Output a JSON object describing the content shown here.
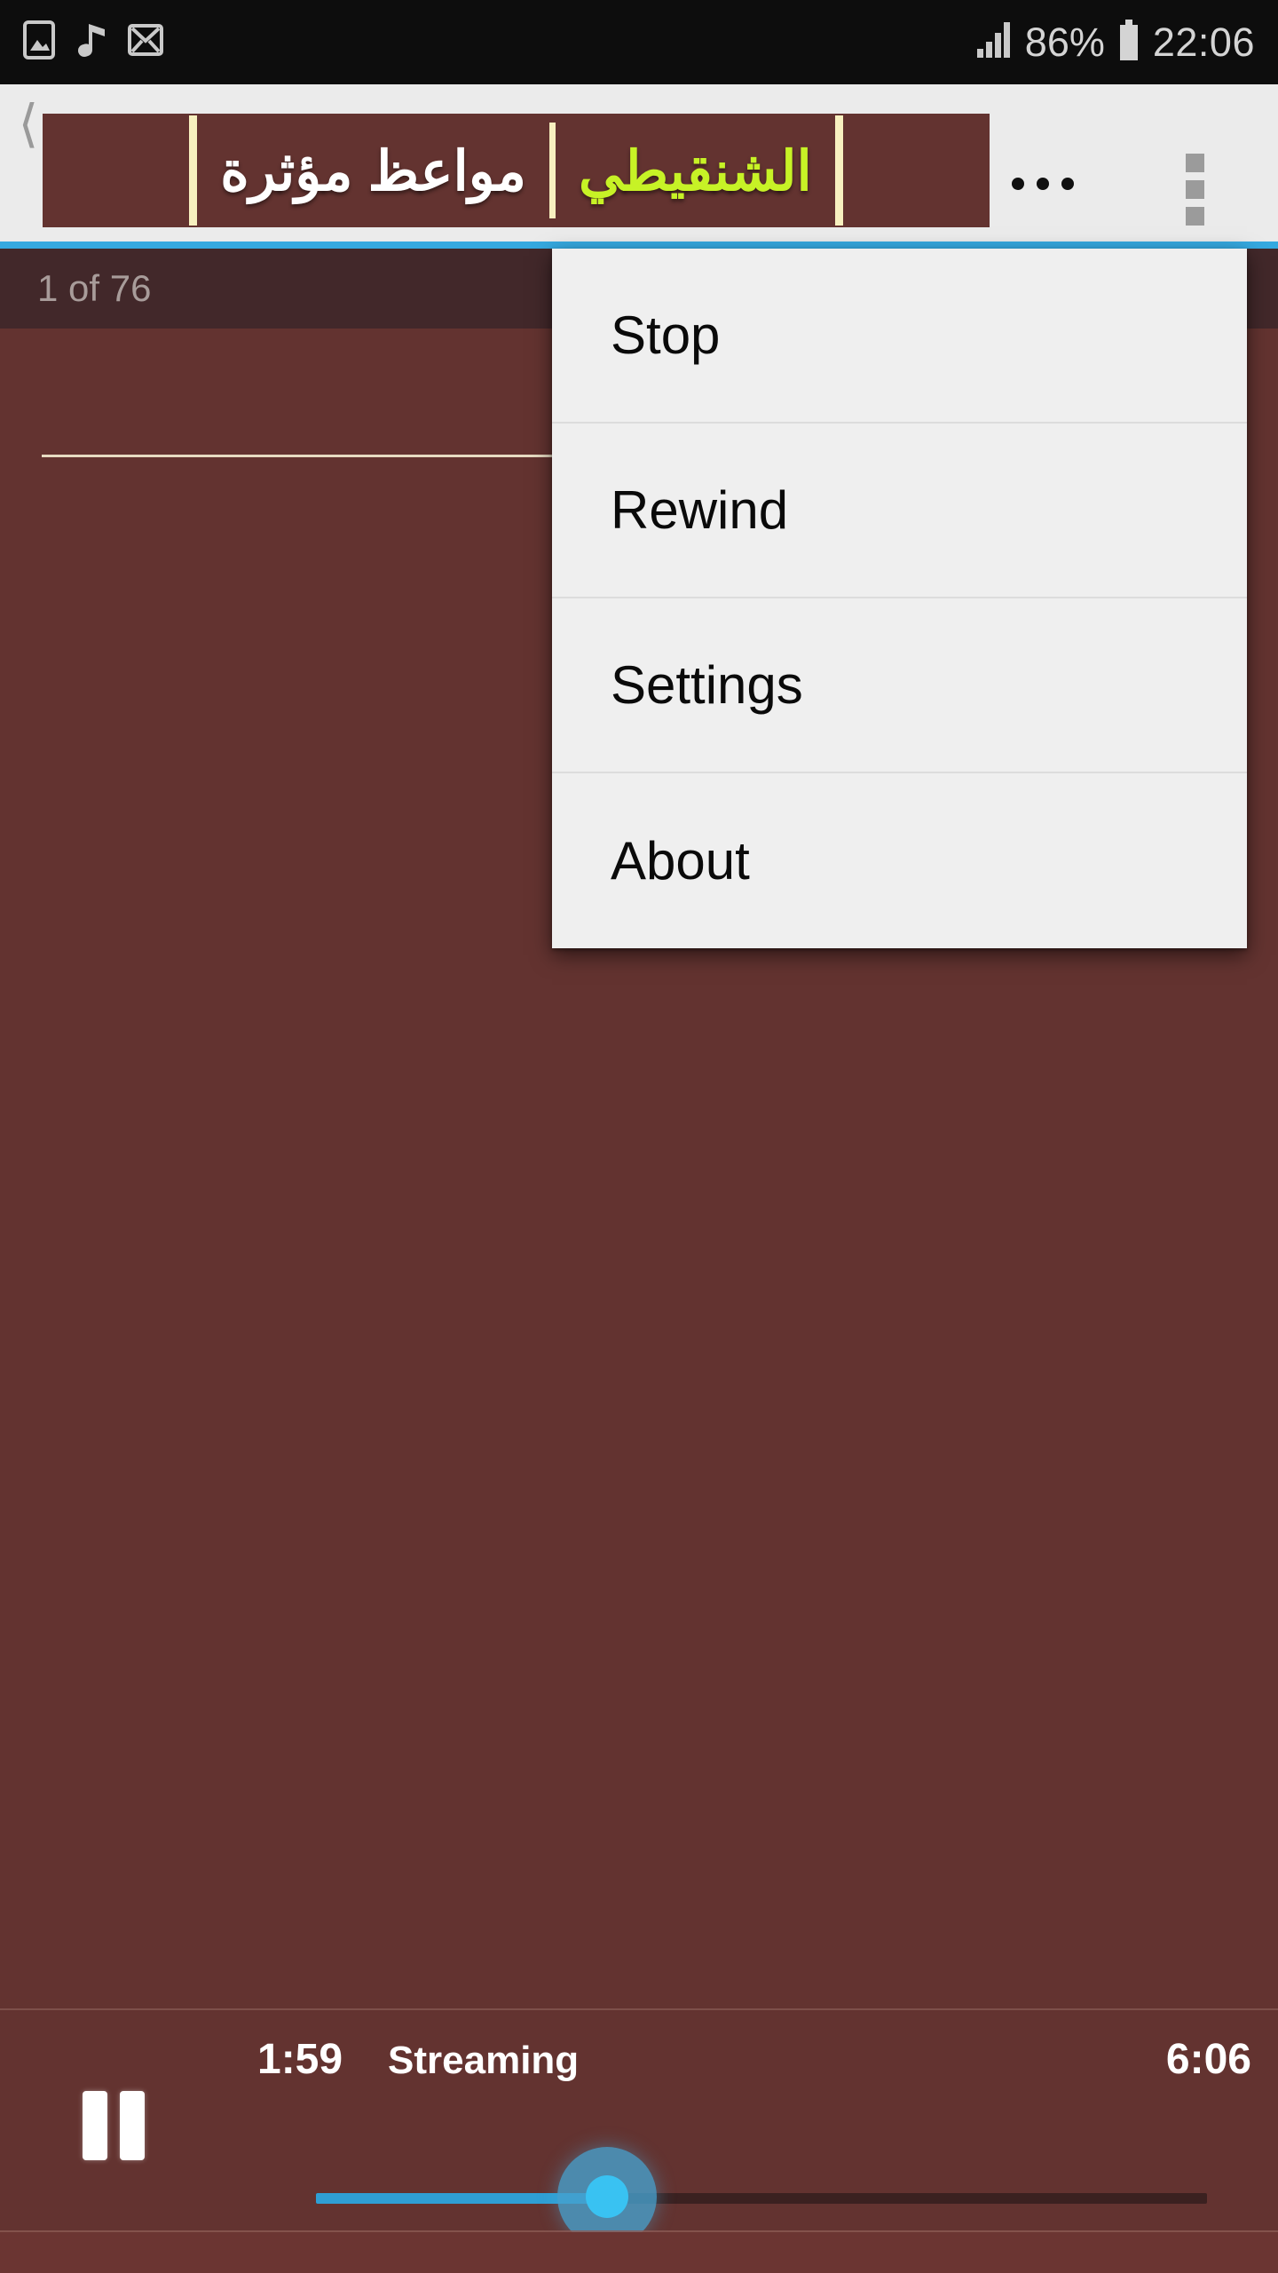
{
  "status_bar": {
    "icons": [
      "image-icon",
      "music-note-icon",
      "mail-icon"
    ],
    "signal_icon": "signal-bars-icon",
    "battery_percent": "86%",
    "battery_icon": "battery-icon",
    "time": "22:06"
  },
  "action_bar": {
    "back_icon": "back-chevron-icon",
    "banner": {
      "title_green": "الشنقيطي",
      "title_white": "مواعظ مؤثرة"
    },
    "ellipsis_label": "…",
    "overflow_icon": "overflow-menu-icon",
    "accent_color": "#36a9e0",
    "background": "#ebebeb"
  },
  "list_header": {
    "counter": "1 of 76"
  },
  "popup_menu": {
    "items": [
      {
        "label": "Stop"
      },
      {
        "label": "Rewind"
      },
      {
        "label": "Settings"
      },
      {
        "label": "About"
      }
    ]
  },
  "player": {
    "pause_icon": "pause-icon",
    "current_time": "1:59",
    "state": "Streaming",
    "total_time": "6:06",
    "seek": {
      "progress_percent": 33,
      "fill_color": "#2f9fd4",
      "track_color": "#3b2120",
      "thumb_color": "#39c2f2"
    }
  },
  "theme": {
    "background": "#633330",
    "header_background": "#42282a",
    "menu_background": "#efefef",
    "accent": "#36a9e0",
    "banner_green": "#c7f226"
  }
}
